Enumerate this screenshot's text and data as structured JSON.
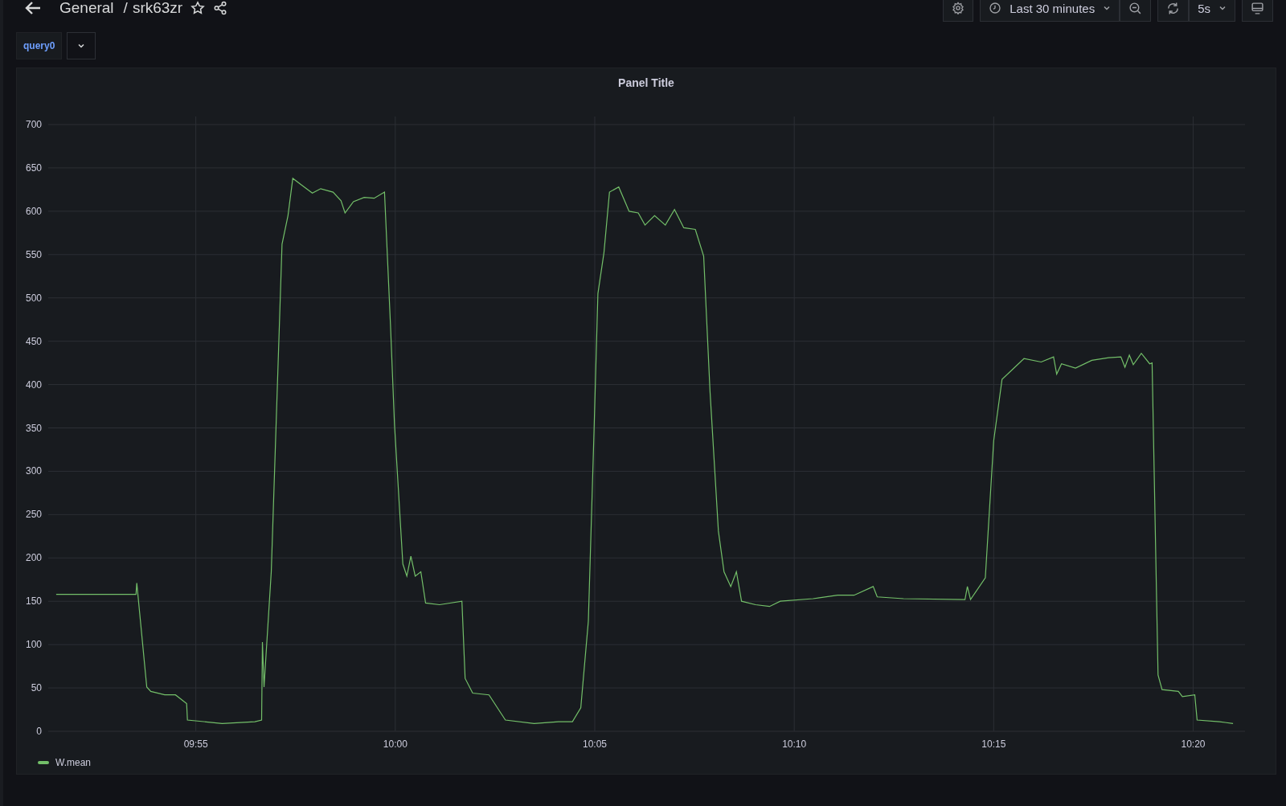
{
  "header": {
    "folder": "General",
    "separator": "/",
    "dashboard": "srk63zr",
    "time_range": "Last 30 minutes",
    "refresh_interval": "5s"
  },
  "variables": {
    "label": "query0"
  },
  "panel": {
    "title": "Panel Title",
    "chart_data": {
      "type": "line",
      "x": [
        591.5,
        593.5,
        593.52,
        593.77,
        593.87,
        594.22,
        594.49,
        594.77,
        594.79,
        595.66,
        596.48,
        596.65,
        596.67,
        596.71,
        596.89,
        597.16,
        597.31,
        597.43,
        597.63,
        597.92,
        598.13,
        598.44,
        598.64,
        598.74,
        598.95,
        599.22,
        599.47,
        599.73,
        599.88,
        599.98,
        600.19,
        600.29,
        600.39,
        600.5,
        600.64,
        600.76,
        601.11,
        601.67,
        601.75,
        601.94,
        602.35,
        602.76,
        603.48,
        604.09,
        604.44,
        604.65,
        604.84,
        604.98,
        605.08,
        605.23,
        605.37,
        605.6,
        605.86,
        606.09,
        606.26,
        606.5,
        606.77,
        607.0,
        607.23,
        607.52,
        607.73,
        607.89,
        608.1,
        608.24,
        608.41,
        608.55,
        608.68,
        609.03,
        609.38,
        609.65,
        610.47,
        611.09,
        611.5,
        611.98,
        612.08,
        612.74,
        614.28,
        614.34,
        614.42,
        614.79,
        615.0,
        615.21,
        615.76,
        616.19,
        616.5,
        616.58,
        616.7,
        617.05,
        617.46,
        617.88,
        618.19,
        618.29,
        618.4,
        618.5,
        618.7,
        618.91,
        618.97,
        619.12,
        619.22,
        619.63,
        619.73,
        620.04,
        620.1,
        620.66,
        621.0
      ],
      "series": [
        {
          "name": "W.mean",
          "color": "#73bf69",
          "values": [
            158,
            158,
            171,
            51,
            46,
            42,
            42,
            32,
            13,
            9,
            11,
            13,
            103,
            51,
            184,
            562,
            595,
            638,
            631,
            621,
            626,
            622,
            612,
            598,
            611,
            616,
            615,
            622,
            467,
            354,
            193,
            179,
            202,
            179,
            184,
            148,
            146,
            150,
            61,
            44,
            42,
            13,
            9,
            11,
            11,
            27,
            127,
            344,
            505,
            552,
            622,
            628,
            600,
            598,
            584,
            595,
            584,
            602,
            581,
            579,
            548,
            392,
            231,
            184,
            167,
            184,
            150,
            146,
            144,
            150,
            153,
            157,
            157,
            167,
            155,
            153,
            152,
            167,
            152,
            177,
            335,
            406,
            430,
            426,
            432,
            412,
            424,
            419,
            428,
            431,
            432,
            420,
            434,
            423,
            436,
            424,
            425,
            65,
            48,
            46,
            40,
            42,
            13,
            11,
            9
          ]
        }
      ],
      "xlim": [
        591.3,
        621.3
      ],
      "ylim": [
        0,
        700
      ],
      "grid": true,
      "xticks": [
        {
          "value": 595,
          "label": "09:55"
        },
        {
          "value": 600,
          "label": "10:00"
        },
        {
          "value": 605,
          "label": "10:05"
        },
        {
          "value": 610,
          "label": "10:10"
        },
        {
          "value": 615,
          "label": "10:15"
        },
        {
          "value": 620,
          "label": "10:20"
        }
      ],
      "yticks": [
        0,
        50,
        100,
        150,
        200,
        250,
        300,
        350,
        400,
        450,
        500,
        550,
        600,
        650,
        700
      ]
    }
  }
}
